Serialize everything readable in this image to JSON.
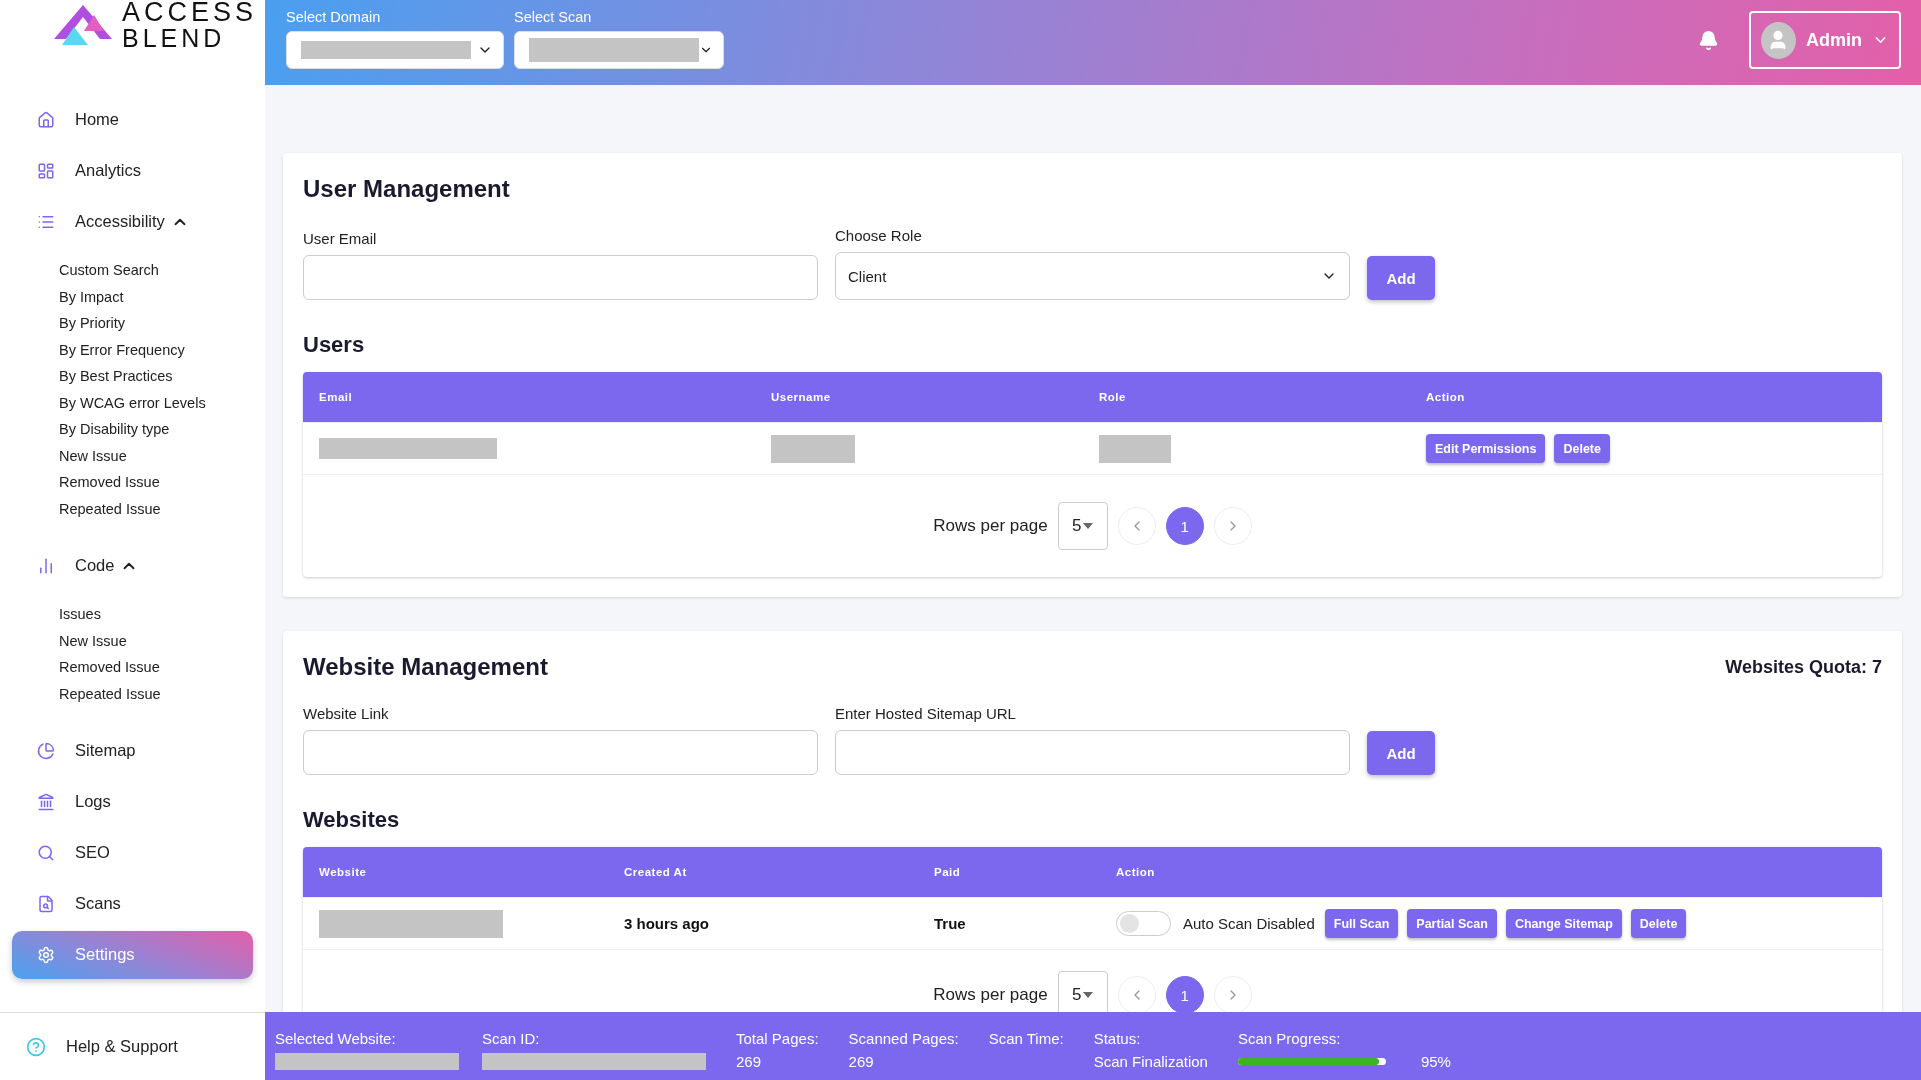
{
  "logo": {
    "line1": "ACCESS",
    "line2": "BLEND"
  },
  "header": {
    "domain_label": "Select Domain",
    "scan_label": "Select Scan",
    "user": "Admin"
  },
  "sidebar": {
    "items": [
      {
        "label": "Home",
        "selected": false
      },
      {
        "label": "Analytics",
        "selected": false
      },
      {
        "label": "Accessibility",
        "selected": false,
        "expanded": true,
        "children": [
          {
            "label": "Custom Search"
          },
          {
            "label": "By Impact"
          },
          {
            "label": "By Priority"
          },
          {
            "label": "By Error Frequency"
          },
          {
            "label": "By Best Practices"
          },
          {
            "label": "By WCAG error Levels"
          },
          {
            "label": "By Disability type"
          },
          {
            "label": "New Issue"
          },
          {
            "label": "Removed Issue"
          },
          {
            "label": "Repeated Issue"
          }
        ]
      },
      {
        "label": "Code",
        "selected": false,
        "expanded": true,
        "children": [
          {
            "label": "Issues"
          },
          {
            "label": "New Issue"
          },
          {
            "label": "Removed Issue"
          },
          {
            "label": "Repeated Issue"
          }
        ]
      },
      {
        "label": "Sitemap",
        "selected": false
      },
      {
        "label": "Logs",
        "selected": false
      },
      {
        "label": "SEO",
        "selected": false
      },
      {
        "label": "Scans",
        "selected": false
      },
      {
        "label": "Settings",
        "selected": true
      }
    ],
    "help": "Help & Support"
  },
  "user_management": {
    "title": "User Management",
    "email_label": "User Email",
    "role_label": "Choose Role",
    "role_value": "Client",
    "add": "Add",
    "users_title": "Users",
    "table": {
      "columns": [
        "Email",
        "Username",
        "Role",
        "Action"
      ],
      "rows": [
        {
          "actions": [
            "Edit Permissions",
            "Delete"
          ]
        }
      ]
    },
    "pagination": {
      "label": "Rows per page",
      "per_page": "5",
      "pages": [
        {
          "label": "1",
          "selected": true
        }
      ]
    }
  },
  "website_management": {
    "title": "Website Management",
    "quota": "Websites Quota: 7",
    "website_label": "Website Link",
    "sitemap_label": "Enter Hosted Sitemap URL",
    "add": "Add",
    "websites_title": "Websites",
    "table": {
      "columns": [
        "Website",
        "Created At",
        "Paid",
        "Action"
      ],
      "rows": [
        {
          "created_at": "3 hours ago",
          "paid": "True",
          "auto_scan": {
            "on": false,
            "label": "Auto Scan Disabled"
          },
          "actions": [
            "Full Scan",
            "Partial Scan",
            "Change Sitemap",
            "Delete"
          ]
        }
      ]
    },
    "pagination": {
      "label": "Rows per page",
      "per_page": "5",
      "pages": [
        {
          "label": "1",
          "selected": true
        }
      ]
    }
  },
  "status_bar": [
    {
      "kind": "redacted",
      "label": "Selected Website:"
    },
    {
      "kind": "redacted",
      "label": "Scan ID:"
    },
    {
      "kind": "text",
      "label": "Total Pages:",
      "value": "269"
    },
    {
      "kind": "text",
      "label": "Scanned Pages:",
      "value": "269"
    },
    {
      "kind": "text",
      "label": "Scan Time:"
    },
    {
      "kind": "text",
      "label": "Status:",
      "value": "Scan Finalization"
    },
    {
      "kind": "progress",
      "label": "Scan Progress:",
      "level": 0.95,
      "reading": "95%"
    }
  ]
}
